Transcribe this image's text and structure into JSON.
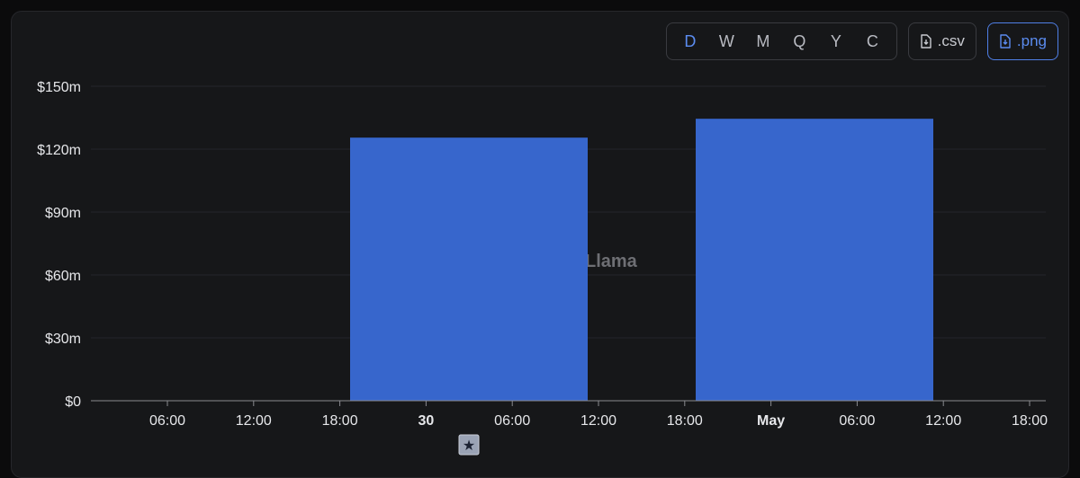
{
  "toolbar": {
    "ranges": [
      "D",
      "W",
      "M",
      "Q",
      "Y",
      "C"
    ],
    "active_range": "D",
    "csv_label": ".csv",
    "png_label": ".png"
  },
  "watermark": "Llama",
  "colors": {
    "bar": "#3766cc",
    "accent": "#5b8cf0",
    "background": "#161719"
  },
  "chart_data": {
    "type": "bar",
    "title": "",
    "xlabel": "",
    "ylabel": "",
    "y_ticks": [
      "$0",
      "$30m",
      "$60m",
      "$90m",
      "$120m",
      "$150m"
    ],
    "ylim": [
      0,
      150000000
    ],
    "x_ticks": [
      "06:00",
      "12:00",
      "18:00",
      "30",
      "06:00",
      "12:00",
      "18:00",
      "May",
      "06:00",
      "12:00",
      "18:00"
    ],
    "x_ticks_bold": [
      "30",
      "May"
    ],
    "categories": [
      "30",
      "May"
    ],
    "values": [
      125500000,
      134500000
    ],
    "grid": true,
    "legend": "none",
    "event_marker": "star"
  }
}
